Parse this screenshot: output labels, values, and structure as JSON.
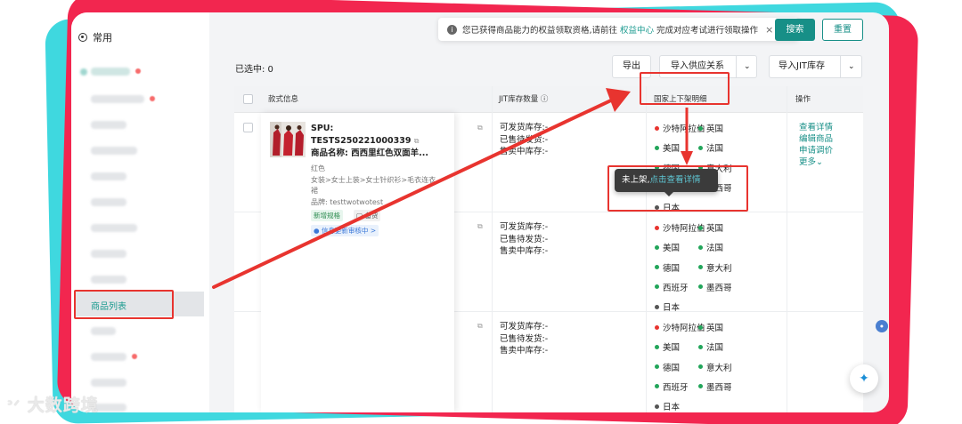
{
  "sidebar": {
    "common_label": "常用",
    "active_item": "商品列表"
  },
  "notice": {
    "text_before": "您已获得商品能力的权益领取资格,请前往",
    "link": "权益中心",
    "text_after": "完成对应考试进行领取操作",
    "close": "×"
  },
  "toolbar": {
    "search": "搜索",
    "reset": "重置",
    "selected": "已选中: 0",
    "export": "导出",
    "import_supply": "导入供应关系",
    "import_jit": "导入JIT库存"
  },
  "table": {
    "headers": {
      "style_info": "款式信息",
      "jit_stock": "JIT库存数量",
      "country_detail": "国家上下架明细",
      "action": "操作"
    },
    "product": {
      "spu_label": "SPU:",
      "spu_code": "TESTS250221000339",
      "name": "商品名称: 西西里红色双面羊...",
      "color": "红色",
      "category": "女装>女士上装>女士针织衫>毛衣连衣",
      "category_cont": "裙",
      "brand": "品牌: testtwotwotest",
      "tag_new": "新增规格",
      "tag_stock": "备货",
      "review": "信息更新审核中 >"
    },
    "jit_lines": [
      "可发货库存:-",
      "已售待发货:-",
      "售卖中库存:-"
    ],
    "rows": [
      {
        "countries": [
          {
            "name": "沙特阿拉伯",
            "status": "red"
          },
          {
            "name": "英国",
            "status": "green"
          },
          {
            "name": "美国",
            "status": "green"
          },
          {
            "name": "法国",
            "status": "green"
          },
          {
            "name": "德国",
            "status": "green"
          },
          {
            "name": "意大利",
            "status": "green"
          },
          {
            "name": "西班牙",
            "status": "green"
          },
          {
            "name": "墨西哥",
            "status": "green"
          },
          {
            "name": "日本",
            "status": "gray"
          }
        ]
      },
      {
        "countries": [
          {
            "name": "沙特阿拉伯",
            "status": "red"
          },
          {
            "name": "英国",
            "status": "green"
          },
          {
            "name": "美国",
            "status": "green"
          },
          {
            "name": "法国",
            "status": "green"
          },
          {
            "name": "德国",
            "status": "green"
          },
          {
            "name": "意大利",
            "status": "green"
          },
          {
            "name": "西班牙",
            "status": "green"
          },
          {
            "name": "墨西哥",
            "status": "green"
          },
          {
            "name": "日本",
            "status": "gray"
          }
        ]
      },
      {
        "countries": [
          {
            "name": "沙特阿拉伯",
            "status": "red"
          },
          {
            "name": "英国",
            "status": "green"
          },
          {
            "name": "美国",
            "status": "green"
          },
          {
            "name": "法国",
            "status": "green"
          },
          {
            "name": "德国",
            "status": "green"
          },
          {
            "name": "意大利",
            "status": "green"
          },
          {
            "name": "西班牙",
            "status": "green"
          },
          {
            "name": "墨西哥",
            "status": "green"
          },
          {
            "name": "日本",
            "status": "gray"
          }
        ]
      }
    ],
    "actions": [
      "查看详情",
      "编辑商品",
      "申请调价",
      "更多"
    ]
  },
  "tooltip": {
    "status": "未上架,",
    "link": "点击查看详情"
  },
  "colors": {
    "accent": "#178f87",
    "status_red": "#e8342f",
    "status_green": "#22a55a",
    "status_gray": "#555555",
    "annotation": "#e8342f"
  },
  "watermark": "大数跨境",
  "icons": {
    "info": "info-icon",
    "close": "close-icon",
    "chevron": "chevron-down-icon",
    "ai": "sparkle-icon"
  }
}
